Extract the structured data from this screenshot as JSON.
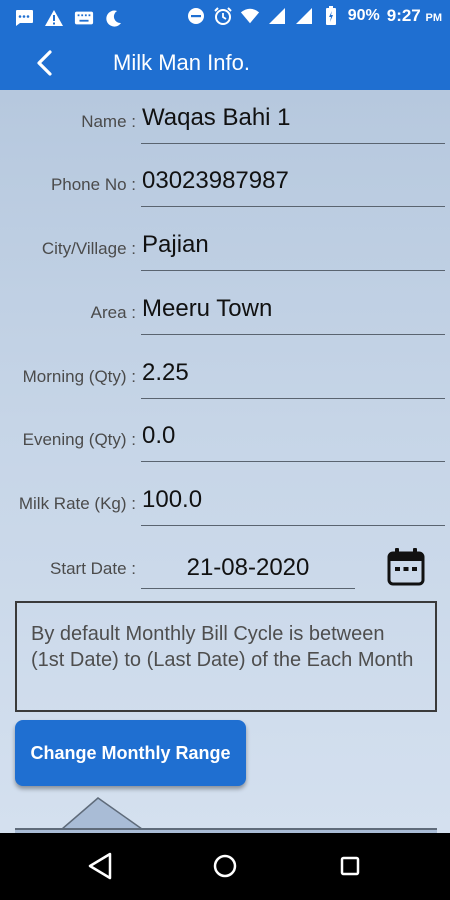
{
  "status_bar": {
    "icons_left": [
      "message-icon",
      "warning-icon",
      "keyboard-icon",
      "moon-icon"
    ],
    "icons_right": [
      "dnd-icon",
      "alarm-icon",
      "wifi-icon",
      "signal-icon",
      "signal-icon",
      "battery-icon"
    ],
    "battery": "90%",
    "time": "9:27",
    "ampm": "PM"
  },
  "app_bar": {
    "title": "Milk Man Info."
  },
  "fields": {
    "name": {
      "label": "Name :",
      "value": "Waqas Bahi 1"
    },
    "phone": {
      "label": "Phone No :",
      "value": "03023987987"
    },
    "city": {
      "label": "City/Village :",
      "value": "Pajian"
    },
    "area": {
      "label": "Area :",
      "value": "Meeru Town"
    },
    "morning": {
      "label": "Morning (Qty) :",
      "value": "2.25"
    },
    "evening": {
      "label": "Evening (Qty) :",
      "value": "0.0"
    },
    "rate": {
      "label": "Milk Rate (Kg) :",
      "value": "100.0"
    },
    "start_date": {
      "label": "Start Date :",
      "value": "21-08-2020"
    }
  },
  "info_text": "By default Monthly Bill Cycle is between (1st Date) to (Last Date) of the Each Month",
  "buttons": {
    "change_range": "Change Monthly Range"
  },
  "colors": {
    "primary": "#1f6fd1",
    "background_top": "#b6c8de",
    "background_bottom": "#d4e0ef"
  }
}
